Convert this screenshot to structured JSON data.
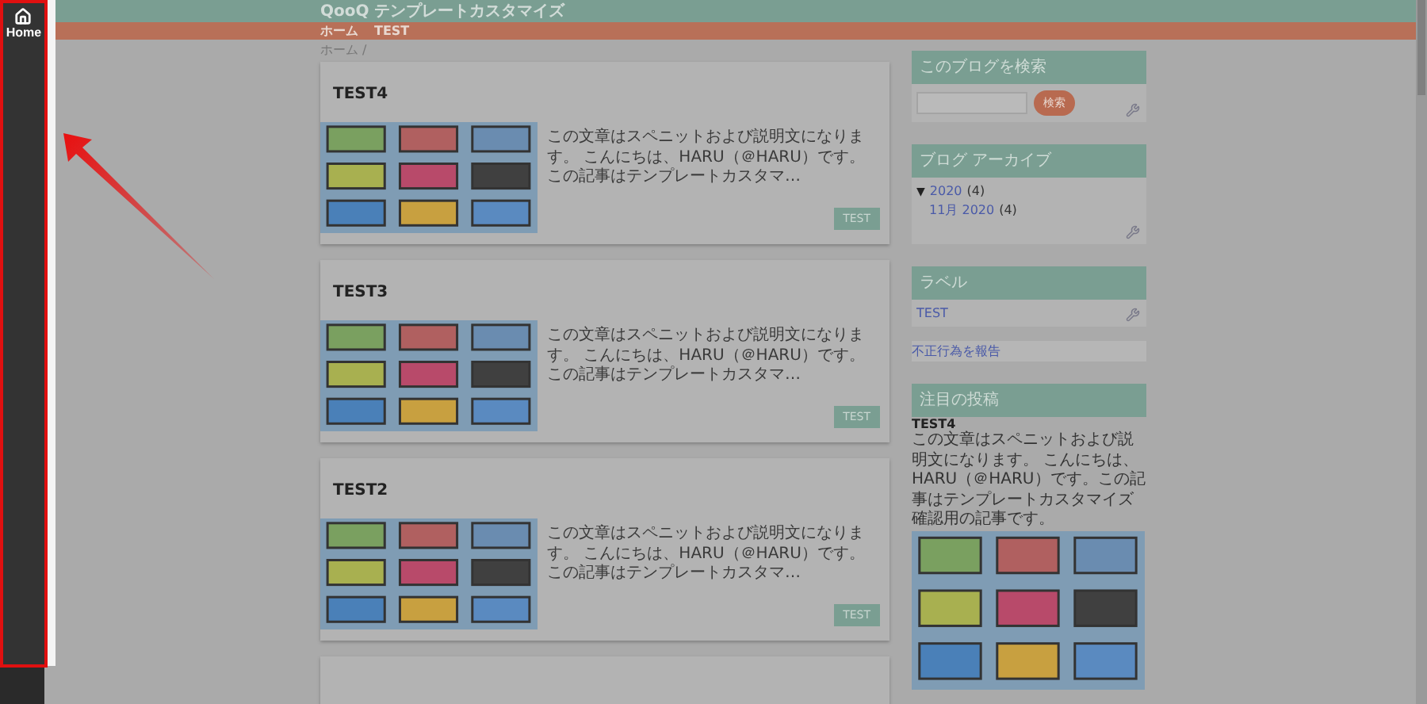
{
  "side_nav": {
    "label": "Home"
  },
  "blog": {
    "title": "QooQ テンプレートカスタマイズ"
  },
  "nav": [
    "ホーム",
    "TEST"
  ],
  "breadcrumb": "ホーム /",
  "posts": [
    {
      "title": "TEST4",
      "snippet": "この文章はスペニットおよび説明文になります。 こんにちは、HARU（＠HARU）です。この記事はテンプレートカスタマ…",
      "label": "TEST"
    },
    {
      "title": "TEST3",
      "snippet": "この文章はスペニットおよび説明文になります。 こんにちは、HARU（＠HARU）です。この記事はテンプレートカスタマ…",
      "label": "TEST"
    },
    {
      "title": "TEST2",
      "snippet": "この文章はスペニットおよび説明文になります。 こんにちは、HARU（＠HARU）です。この記事はテンプレートカスタマ…",
      "label": "TEST"
    }
  ],
  "search_widget": {
    "title": "このブログを検索",
    "button": "検索"
  },
  "archive_widget": {
    "title": "ブログ アーカイブ",
    "years": [
      {
        "toggle": "▼",
        "expanded": true,
        "year": "2020",
        "count": "(4)",
        "months": [
          {
            "month": "11月 2020",
            "count": "(4)"
          }
        ]
      }
    ]
  },
  "labels_widget": {
    "title": "ラベル",
    "labels": [
      "TEST"
    ]
  },
  "report_link": "不正行為を報告",
  "featured_widget": {
    "title": "注目の投稿",
    "post_title": "TEST4",
    "text": "この文章はスペニットおよび説明文になります。 こんにちは、HARU（＠HARU）です。この記事はテンプレートカスタマイズ確認用の記事です。"
  }
}
